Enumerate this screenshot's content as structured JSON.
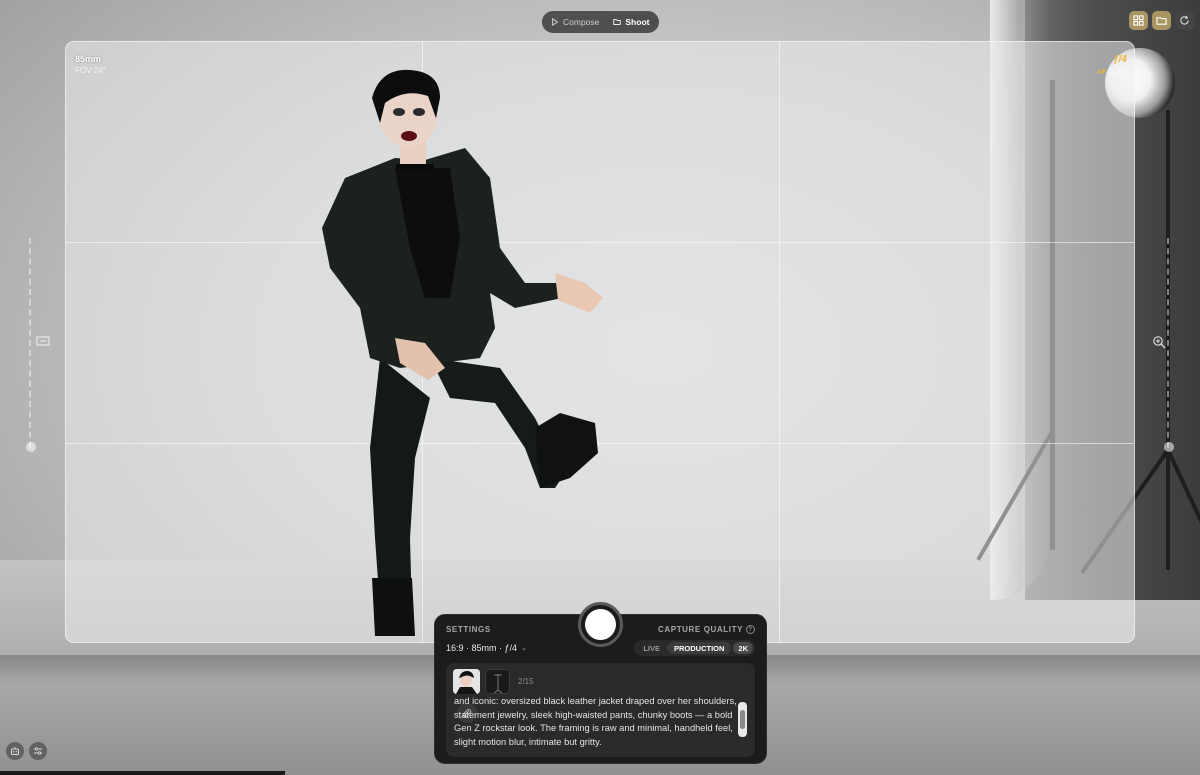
{
  "mode_toggle": {
    "options": [
      {
        "label": "Compose",
        "icon": "play-icon",
        "active": false
      },
      {
        "label": "Shoot",
        "icon": "folder-icon",
        "active": true
      }
    ]
  },
  "top_right_buttons": [
    {
      "icon": "grid-icon",
      "active": true
    },
    {
      "icon": "folder-icon",
      "active": true
    },
    {
      "icon": "refresh-icon",
      "active": false
    }
  ],
  "viewfinder": {
    "focal_length": "85mm",
    "fov": "FOV 24°",
    "aperture": "ƒ/4",
    "af_label": "AF",
    "af_value": "5.3m"
  },
  "left_control": {
    "icon": "frame-icon"
  },
  "right_control": {
    "icon": "zoom-icon"
  },
  "bottom_left_buttons": [
    {
      "icon": "robot-icon"
    },
    {
      "icon": "sliders-icon"
    }
  ],
  "settings_panel": {
    "title": "SETTINGS",
    "spec": "16:9 · 85mm · ƒ/4",
    "capture_quality_label": "CAPTURE QUALITY",
    "quality_options": [
      "LIVE",
      "PRODUCTION"
    ],
    "quality_selected": "PRODUCTION",
    "resolution": "2K",
    "reference_count": "2/15",
    "prompt_text": "and iconic: oversized black leather jacket draped over her shoulders, statement jewelry, sleek high-waisted pants, chunky boots — a bold Gen Z rockstar look. The framing is raw and minimal, handheld feel, slight motion blur, intimate but gritty."
  },
  "colors": {
    "accent_gold": "#e7b53a",
    "panel_bg": "#1c1c1d",
    "active_button": "#a99561"
  }
}
